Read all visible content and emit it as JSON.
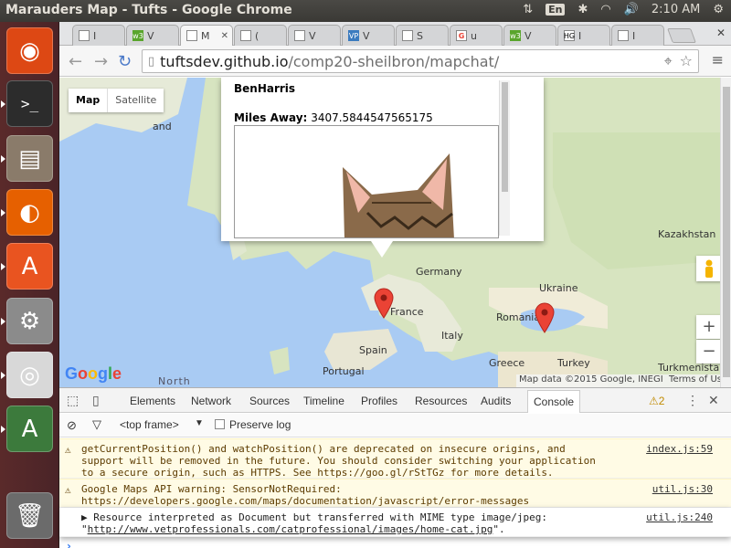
{
  "window": {
    "title": "Marauders Map - Tufts - Google Chrome"
  },
  "tray": {
    "lang": "En",
    "time": "2:10 AM"
  },
  "launcher": [
    {
      "name": "ubuntu-dash",
      "bg": "#dd4814",
      "glyph": "◉"
    },
    {
      "name": "terminal",
      "bg": "#2c2c2c",
      "glyph": ">_"
    },
    {
      "name": "files",
      "bg": "#8a7b6a",
      "glyph": "▤"
    },
    {
      "name": "firefox",
      "bg": "#e66000",
      "glyph": "◐"
    },
    {
      "name": "software-center",
      "bg": "#e95420",
      "glyph": "A"
    },
    {
      "name": "system-settings",
      "bg": "#8b8b8b",
      "glyph": "⚙"
    },
    {
      "name": "chrome",
      "bg": "#d8d8d8",
      "glyph": "◎"
    },
    {
      "name": "update-manager",
      "bg": "#3c7a3c",
      "glyph": "A"
    },
    {
      "name": "trash",
      "bg": "#6b6b6b",
      "glyph": "🗑"
    }
  ],
  "tabs": [
    {
      "fav": "",
      "label": "I"
    },
    {
      "fav": "w3",
      "label": "V"
    },
    {
      "fav": "",
      "label": "M"
    },
    {
      "fav": "",
      "label": "("
    },
    {
      "fav": "",
      "label": "V"
    },
    {
      "fav": "VP",
      "label": "V"
    },
    {
      "fav": "",
      "label": "S"
    },
    {
      "fav": "G",
      "label": "u"
    },
    {
      "fav": "w3",
      "label": "V"
    },
    {
      "fav": "HG",
      "label": "I"
    },
    {
      "fav": "",
      "label": "I"
    }
  ],
  "omnibar": {
    "url_host": "tuftsdev.github.io",
    "url_path": "/comp20-sheilbron/mapchat/"
  },
  "map": {
    "type_map": "Map",
    "type_satellite": "Satellite",
    "labels": [
      "Germany",
      "France",
      "Italy",
      "Spain",
      "Portugal",
      "Ukraine",
      "Romania",
      "Greece",
      "Turkey",
      "Turkmenista",
      "Kazakhstan",
      "North",
      "and"
    ],
    "info": {
      "name": "BenHarris",
      "miles_label": "Miles Away:",
      "miles_value": "3407.5844547565175"
    },
    "attribution": "Map data ©2015 Google, INEGI",
    "terms": "Terms of Use",
    "logo": "Google",
    "zoom_in": "+",
    "zoom_out": "−"
  },
  "devtools": {
    "tabs": [
      "Elements",
      "Network",
      "Sources",
      "Timeline",
      "Profiles",
      "Resources",
      "Audits",
      "Console"
    ],
    "warn_count": "2",
    "frame": "<top frame>",
    "preserve_log": "Preserve log",
    "messages": [
      {
        "type": "warn",
        "text": "getCurrentPosition() and watchPosition() are deprecated on insecure origins, and support will be removed in the future. You should consider switching your application to a secure origin, such as HTTPS. See https://goo.gl/rStTGz for more details.",
        "src": "index.js:59"
      },
      {
        "type": "warn",
        "text": "Google Maps API warning: SensorNotRequired: https://developers.google.com/maps/documentation/javascript/error-messages",
        "src": "util.js:30"
      },
      {
        "type": "info",
        "text": "▶ Resource interpreted as Document but transferred with MIME type image/jpeg: \"",
        "link": "http://www.vetprofessionals.com/catprofessional/images/home-cat.jpg",
        "end": "\".",
        "src": "util.js:240"
      }
    ]
  }
}
